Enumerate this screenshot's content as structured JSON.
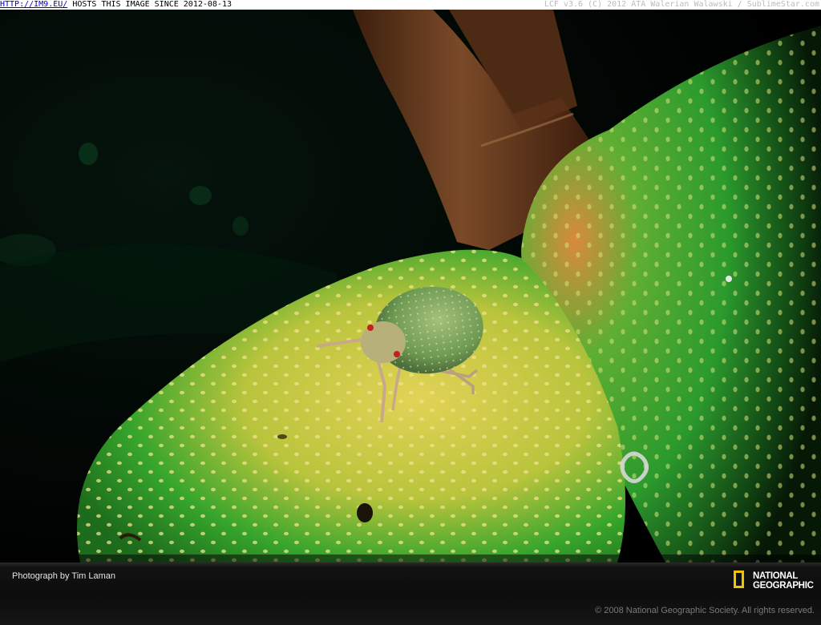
{
  "topbar": {
    "link_text": "HTTP://IM9.EU/",
    "host_text": " HOSTS THIS IMAGE SINCE 2012-08-13",
    "right_text": "LCF v3.6 (C) 2012 ATA Walerian Walawski / SublimeStar.com"
  },
  "footer": {
    "credit": "Photograph by Tim Laman",
    "copyright": "© 2008 National Geographic Society. All rights reserved.",
    "logo_line1": "NATIONAL",
    "logo_line2": "GEOGRAPHIC"
  },
  "colors": {
    "logo_yellow": "#f2c400",
    "fruit_green": "#2f9e2a",
    "fruit_yellow": "#d8c64a",
    "stem_brown": "#6a3c1f"
  }
}
